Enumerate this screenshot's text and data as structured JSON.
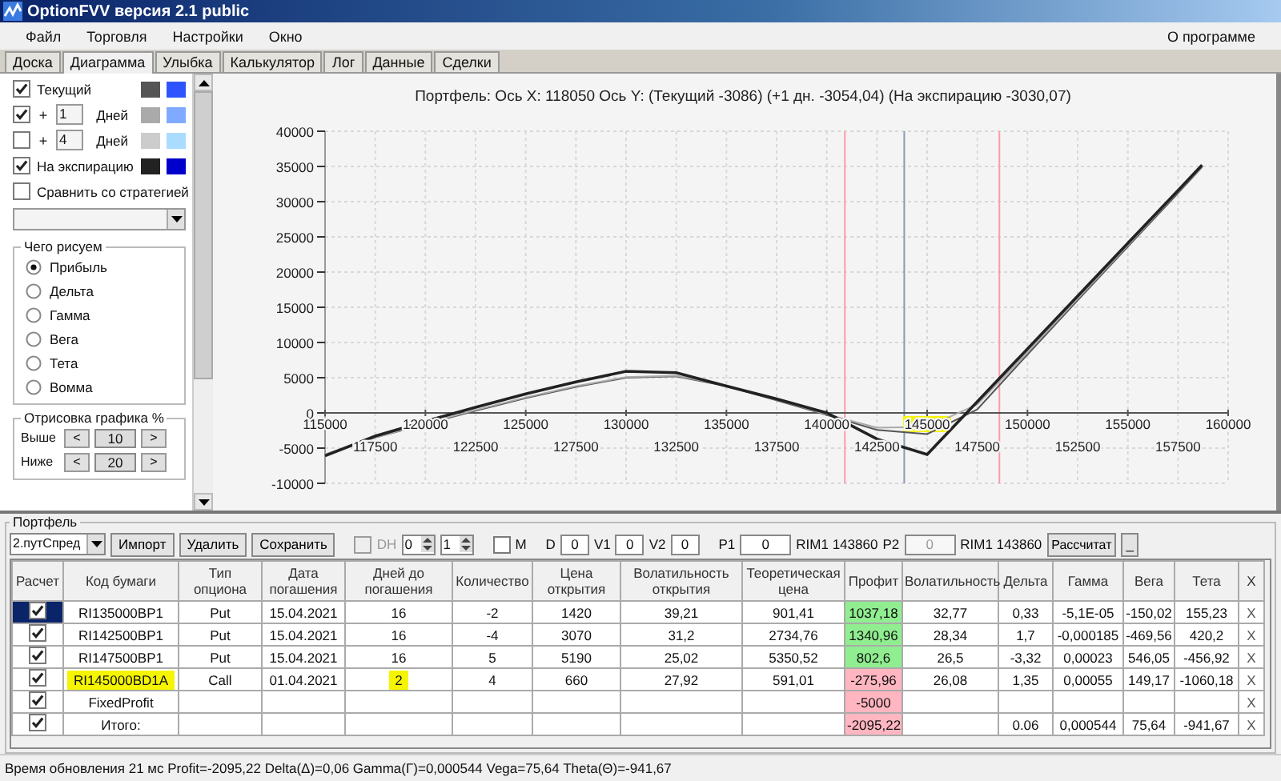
{
  "window": {
    "title": "OptionFVV версия 2.1 public"
  },
  "menu": [
    {
      "label": "Файл"
    },
    {
      "label": "Торговля"
    },
    {
      "label": "Настройки"
    },
    {
      "label": "Окно"
    }
  ],
  "about": "О программе",
  "tabs": [
    {
      "label": "Доска",
      "selected": false
    },
    {
      "label": "Диаграмма",
      "selected": true
    },
    {
      "label": "Улыбка",
      "selected": false
    },
    {
      "label": "Калькулятор",
      "selected": false
    },
    {
      "label": "Лог",
      "selected": false
    },
    {
      "label": "Данные",
      "selected": false
    },
    {
      "label": "Сделки",
      "selected": false
    }
  ],
  "curves_panel": {
    "curves": [
      {
        "kind": "label",
        "checked": true,
        "label": "Текущий",
        "swatches": [
          {
            "color": "#555555"
          },
          {
            "color": "#2f54ff"
          }
        ]
      },
      {
        "kind": "days",
        "checked": true,
        "sign": "+",
        "days": "1",
        "unit": "Дней",
        "swatches": [
          {
            "color": "#aaaaaa"
          },
          {
            "color": "#80aaff"
          }
        ]
      },
      {
        "kind": "days",
        "checked": false,
        "sign": "+",
        "days": "4",
        "unit": "Дней",
        "swatches": [
          {
            "color": "#cccccc"
          },
          {
            "color": "#aadcff"
          }
        ]
      },
      {
        "kind": "label",
        "checked": true,
        "label": "На экспирацию",
        "swatches": [
          {
            "color": "#222222"
          },
          {
            "color": "#0000cc"
          }
        ]
      }
    ],
    "compare": {
      "label": "Сравнить со стратегией",
      "checked": false
    },
    "plot_group": {
      "title": "Чего рисуем",
      "options": [
        {
          "label": "Прибыль",
          "selected": true
        },
        {
          "label": "Дельта",
          "selected": false
        },
        {
          "label": "Гамма",
          "selected": false
        },
        {
          "label": "Вега",
          "selected": false
        },
        {
          "label": "Тета",
          "selected": false
        },
        {
          "label": "Вомма",
          "selected": false
        }
      ]
    },
    "range_group": {
      "title": "Отрисовка графика %",
      "rows": [
        {
          "label": "Выше",
          "dec": "<",
          "value": "10",
          "inc": ">"
        },
        {
          "label": "Ниже",
          "dec": "<",
          "value": "20",
          "inc": ">"
        }
      ]
    }
  },
  "chart": {
    "x_label_highlights": [
      false,
      false,
      false,
      false,
      false,
      false,
      true,
      false,
      false,
      false
    ],
    "minor_x_labels": [
      "117500",
      "122500",
      "127500",
      "132500",
      "137500",
      "142500",
      "147500",
      "152500",
      "157500"
    ],
    "chart_data": {
      "type": "line",
      "grid": true,
      "title": "Портфель: Ось X: 118050 Ось Y:  (Текущий -3086)  (+1 дн. -3054,04)  (На экспирацию -3030,07)",
      "x": [
        115000,
        117500,
        120000,
        122500,
        125000,
        127500,
        130000,
        132500,
        135000,
        137500,
        140000,
        142500,
        145000,
        147500,
        150000,
        152500,
        155000,
        157500,
        158700
      ],
      "series": [
        {
          "color": "#555555",
          "values": [
            -5900,
            -3500,
            -1600,
            300,
            2100,
            3700,
            5000,
            5200,
            3800,
            1800,
            -300,
            -2400,
            -3000,
            500,
            8300,
            16000,
            23600,
            31200,
            34900
          ]
        },
        {
          "color": "#aaaaaa",
          "values": [
            -5900,
            -3500,
            -1500,
            400,
            2200,
            3800,
            5100,
            5300,
            3900,
            1900,
            -200,
            -2100,
            -2000,
            1200,
            8600,
            16200,
            23800,
            31400,
            35000
          ]
        },
        {
          "color": "#222222",
          "values": [
            -6100,
            -3300,
            -1200,
            800,
            2700,
            4400,
            5900,
            5700,
            3800,
            2000,
            0,
            -3700,
            -5900,
            1600,
            9100,
            16600,
            24100,
            31600,
            35200
          ]
        }
      ],
      "xlim": [
        115000,
        160000
      ],
      "ylim": [
        -10000,
        40000
      ],
      "xticks": [
        115000,
        120000,
        125000,
        130000,
        135000,
        140000,
        145000,
        150000,
        155000,
        160000
      ],
      "yticks": [
        -10000,
        -5000,
        0,
        5000,
        10000,
        15000,
        20000,
        25000,
        30000,
        35000,
        40000
      ],
      "ref_lines": [
        {
          "axis": "x",
          "value": 140900,
          "color": "#ff9aa8"
        },
        {
          "axis": "x",
          "value": 148600,
          "color": "#ff9aa8"
        },
        {
          "axis": "x",
          "value": 143860,
          "color": "#8a9bb0"
        }
      ]
    }
  },
  "portfolio": {
    "title": "Портфель",
    "strategy": "2.путСпред",
    "buttons": [
      "Импорт",
      "Удалить",
      "Сохранить"
    ],
    "dh": {
      "label": "DH",
      "checked": false,
      "disabled": true
    },
    "spins": [
      "0",
      "1"
    ],
    "m": {
      "label": "M",
      "checked": false
    },
    "params": [
      {
        "label": "D",
        "value": "0"
      },
      {
        "label": "V1",
        "value": "0"
      },
      {
        "label": "V2",
        "value": "0"
      }
    ],
    "prices": [
      {
        "label": "P1",
        "value": "0",
        "disabled": false,
        "ticker": "RIM1 143860"
      },
      {
        "label": "P2",
        "value": "0",
        "disabled": true,
        "ticker": "RIM1 143860"
      }
    ],
    "calc_button": "Рассчитат",
    "minimize_button": "_",
    "columns": [
      "Расчет",
      "Код бумаги",
      "Тип опциона",
      "Дата погашения",
      "Дней до погашения",
      "Количество",
      "Цена открытия",
      "Волатильность открытия",
      "Теоретическая цена",
      "Профит",
      "Волатильность",
      "Дельта",
      "Гамма",
      "Вега",
      "Тета",
      "X"
    ],
    "rows": [
      {
        "selected": true,
        "checked": true,
        "code": "RI135000BP1",
        "code_marked": false,
        "type": "Put",
        "expiry": "15.04.2021",
        "days": "16",
        "days_marked": false,
        "qty": "-2",
        "open_price": "1420",
        "open_vol": "39,21",
        "theo_price": "901,41",
        "profit": "1037,18",
        "color": "#90ee90",
        "vol": "32,77",
        "delta": "0,33",
        "gamma": "-5,1E-05",
        "vega": "-150,02",
        "theta": "155,23",
        "remove": "X"
      },
      {
        "selected": false,
        "checked": true,
        "code": "RI142500BP1",
        "code_marked": false,
        "type": "Put",
        "expiry": "15.04.2021",
        "days": "16",
        "days_marked": false,
        "qty": "-4",
        "open_price": "3070",
        "open_vol": "31,2",
        "theo_price": "2734,76",
        "profit": "1340,96",
        "color": "#90ee90",
        "vol": "28,34",
        "delta": "1,7",
        "gamma": "-0,000185",
        "vega": "-469,56",
        "theta": "420,2",
        "remove": "X"
      },
      {
        "selected": false,
        "checked": true,
        "code": "RI147500BP1",
        "code_marked": false,
        "type": "Put",
        "expiry": "15.04.2021",
        "days": "16",
        "days_marked": false,
        "qty": "5",
        "open_price": "5190",
        "open_vol": "25,02",
        "theo_price": "5350,52",
        "profit": "802,6",
        "color": "#90ee90",
        "vol": "26,5",
        "delta": "-3,32",
        "gamma": "0,00023",
        "vega": "546,05",
        "theta": "-456,92",
        "remove": "X"
      },
      {
        "selected": false,
        "checked": true,
        "code": "RI145000BD1A",
        "code_marked": true,
        "type": "Call",
        "expiry": "01.04.2021",
        "days": "2",
        "days_marked": true,
        "qty": "4",
        "open_price": "660",
        "open_vol": "27,92",
        "theo_price": "591,01",
        "profit": "-275,96",
        "color": "#ffb6c1",
        "vol": "26,08",
        "delta": "1,35",
        "gamma": "0,00055",
        "vega": "149,17",
        "theta": "-1060,18",
        "remove": "X"
      },
      {
        "selected": false,
        "checked": true,
        "code": "FixedProfit",
        "code_marked": false,
        "days_marked": false,
        "profit": "-5000",
        "color": "#ffb6c1",
        "remove": "X"
      },
      {
        "selected": false,
        "checked": true,
        "code": "Итого:",
        "code_marked": false,
        "days_marked": false,
        "profit": "-2095,22",
        "color": "#ffb6c1",
        "delta": "0.06",
        "gamma": "0,000544",
        "vega": "75,64",
        "theta": "-941,67",
        "remove": "X"
      }
    ]
  },
  "status_bar": "Время обновления 21 мс  Profit=-2095,22 Delta(Δ)=0,06 Gamma(Γ)=0,000544 Vega=75,64 Theta(Θ)=-941,67"
}
